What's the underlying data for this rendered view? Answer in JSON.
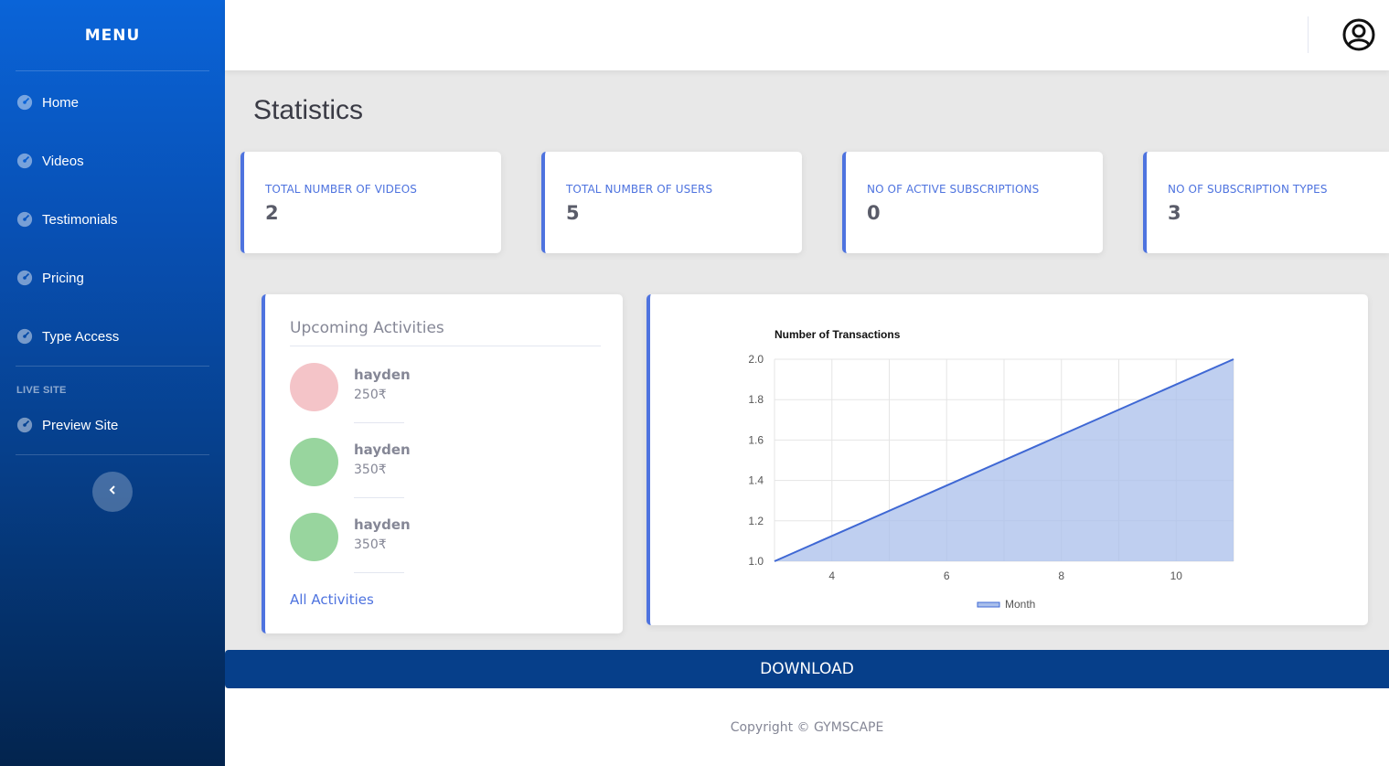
{
  "sidebar": {
    "title": "MENU",
    "items": [
      {
        "label": "Home",
        "icon": "dashboard-icon"
      },
      {
        "label": "Videos",
        "icon": "dashboard-icon"
      },
      {
        "label": "Testimonials",
        "icon": "dashboard-icon"
      },
      {
        "label": "Pricing",
        "icon": "dashboard-icon"
      },
      {
        "label": "Type Access",
        "icon": "dashboard-icon"
      }
    ],
    "section_heading": "LIVE SITE",
    "live_items": [
      {
        "label": "Preview Site",
        "icon": "dashboard-icon"
      }
    ],
    "toggle_icon": "chevron-left-icon"
  },
  "topbar": {
    "user_icon": "user-circle-icon"
  },
  "page_title": "Statistics",
  "stats": [
    {
      "label": "TOTAL NUMBER OF VIDEOS",
      "value": "2"
    },
    {
      "label": "TOTAL NUMBER OF USERS",
      "value": "5"
    },
    {
      "label": "NO OF ACTIVE SUBSCRIPTIONS",
      "value": "0"
    },
    {
      "label": "NO OF SUBSCRIPTION TYPES",
      "value": "3"
    }
  ],
  "activities": {
    "heading": "Upcoming Activities",
    "items": [
      {
        "name": "hayden",
        "price": "250₹",
        "color": "#f4c4c8"
      },
      {
        "name": "hayden",
        "price": "350₹",
        "color": "#98d59e"
      },
      {
        "name": "hayden",
        "price": "350₹",
        "color": "#98d59e"
      }
    ],
    "link": "All Activities"
  },
  "chart_data": {
    "type": "area",
    "title": "Number of Transactions",
    "x": [
      3,
      11
    ],
    "series": [
      {
        "name": "Month",
        "values": [
          1.0,
          2.0
        ]
      }
    ],
    "xlim": [
      3,
      11
    ],
    "ylim": [
      1.0,
      2.0
    ],
    "x_ticks": [
      "4",
      "6",
      "8",
      "10"
    ],
    "y_ticks": [
      "1.0",
      "1.2",
      "1.4",
      "1.6",
      "1.8",
      "2.0"
    ],
    "grid": true,
    "legend": "bottom",
    "colors": {
      "line": "#3f68d4",
      "fill": "#a9bfeb"
    }
  },
  "download_label": "DOWNLOAD",
  "footer": "Copyright © GYMSCAPE",
  "colors": {
    "accent": "#4e73df",
    "sidebar": "#0a64d8",
    "download": "#063f8a"
  }
}
